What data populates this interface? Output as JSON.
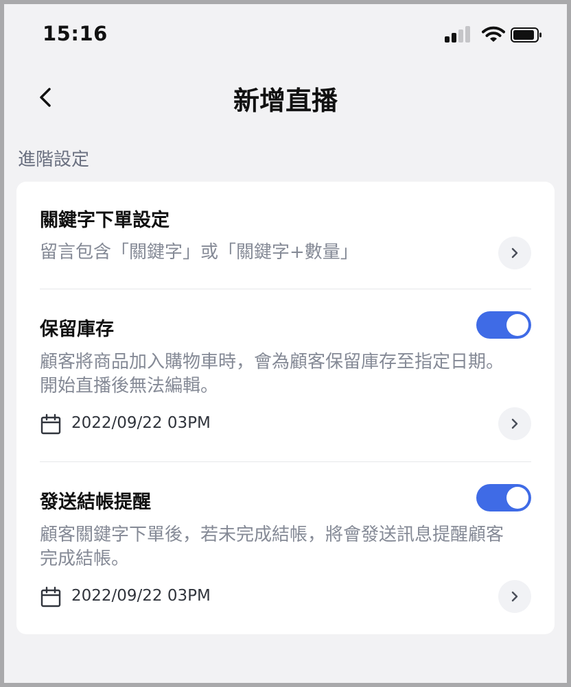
{
  "status_bar": {
    "time": "15:16"
  },
  "nav": {
    "title": "新增直播"
  },
  "section": {
    "label": "進階設定"
  },
  "settings": {
    "keyword_order": {
      "title": "關鍵字下單設定",
      "description": "留言包含「關鍵字」或「關鍵字+數量」"
    },
    "reserve_stock": {
      "title": "保留庫存",
      "description": "顧客將商品加入購物車時，會為顧客保留庫存至指定日期。開始直播後無法編輯。",
      "enabled": true,
      "date": "2022/09/22 03PM"
    },
    "checkout_reminder": {
      "title": "發送結帳提醒",
      "description": "顧客關鍵字下單後，若未完成結帳，將會發送訊息提醒顧客完成結帳。",
      "enabled": true,
      "date": "2022/09/22 03PM"
    }
  },
  "colors": {
    "accent": "#3f6be6",
    "background": "#f2f2f4",
    "card": "#ffffff"
  },
  "icons": [
    "back-chevron",
    "chevron-right",
    "calendar",
    "cellular-signal",
    "wifi",
    "battery"
  ]
}
